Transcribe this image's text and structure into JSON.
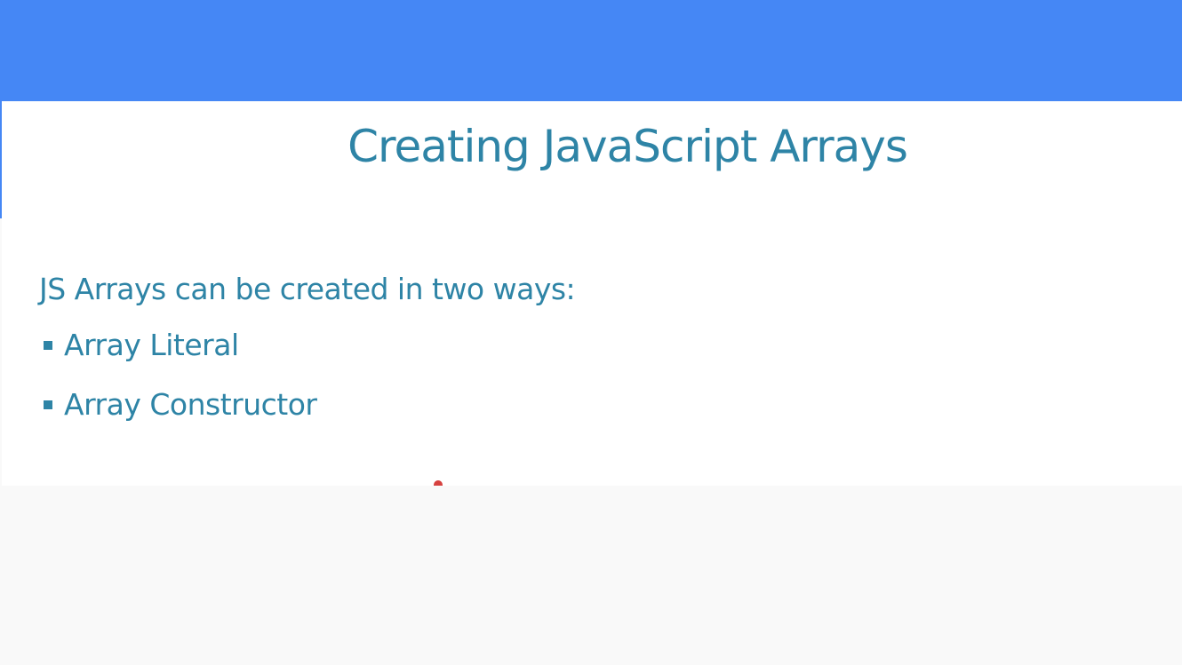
{
  "slide": {
    "title": "Creating JavaScript Arrays",
    "intro": "JS Arrays can be created in two ways:",
    "bullets": [
      {
        "label": "Array Literal"
      },
      {
        "label": "Array Constructor"
      }
    ]
  },
  "colors": {
    "top_bar": "#4587f5",
    "slide_background": "#ffffff",
    "text": "#2e84a6",
    "page_background": "#f9f9f9",
    "cursor": "#d6413f"
  }
}
